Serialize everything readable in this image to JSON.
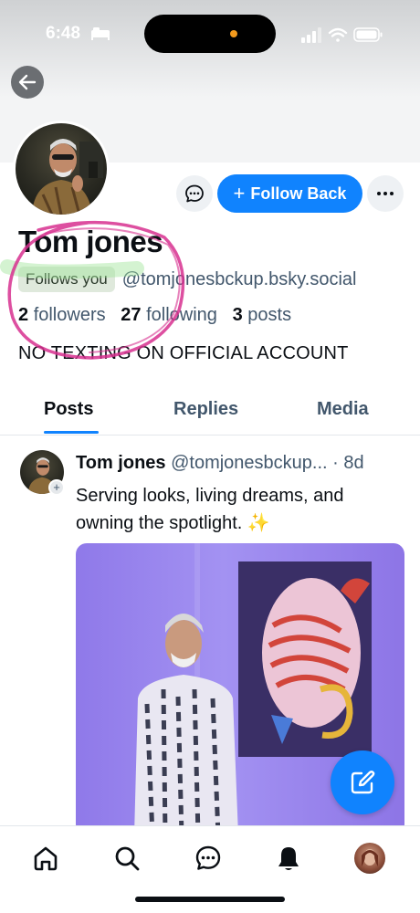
{
  "status_bar": {
    "time": "6:48"
  },
  "profile": {
    "display_name": "Tom jones",
    "follows_you_label": "Follows you",
    "handle": "@tomjonesbckup.bsky.social",
    "followers_count": "2",
    "followers_label": "followers",
    "following_count": "27",
    "following_label": "following",
    "posts_count": "3",
    "posts_label": "posts",
    "bio": "NO TEXTING ON OFFICIAL ACCOUNT",
    "follow_button_label": "Follow Back"
  },
  "tabs": [
    {
      "label": "Posts",
      "active": true
    },
    {
      "label": "Replies",
      "active": false
    },
    {
      "label": "Media",
      "active": false
    }
  ],
  "post": {
    "author_name": "Tom jones",
    "author_handle": "@tomjonesbckup...",
    "separator": "·",
    "age": "8d",
    "text": "Serving looks, living dreams, and owning the spotlight. ✨"
  },
  "colors": {
    "accent": "#1083fe",
    "annotation": "#d7308f",
    "highlight": "#9fe59a"
  },
  "icons": {
    "back": "arrow-left-icon",
    "message": "chat-bubble-icon",
    "more": "ellipsis-icon",
    "compose": "pencil-square-icon",
    "nav": [
      "home-icon",
      "search-icon",
      "chat-icon",
      "bell-icon",
      "avatar"
    ]
  }
}
